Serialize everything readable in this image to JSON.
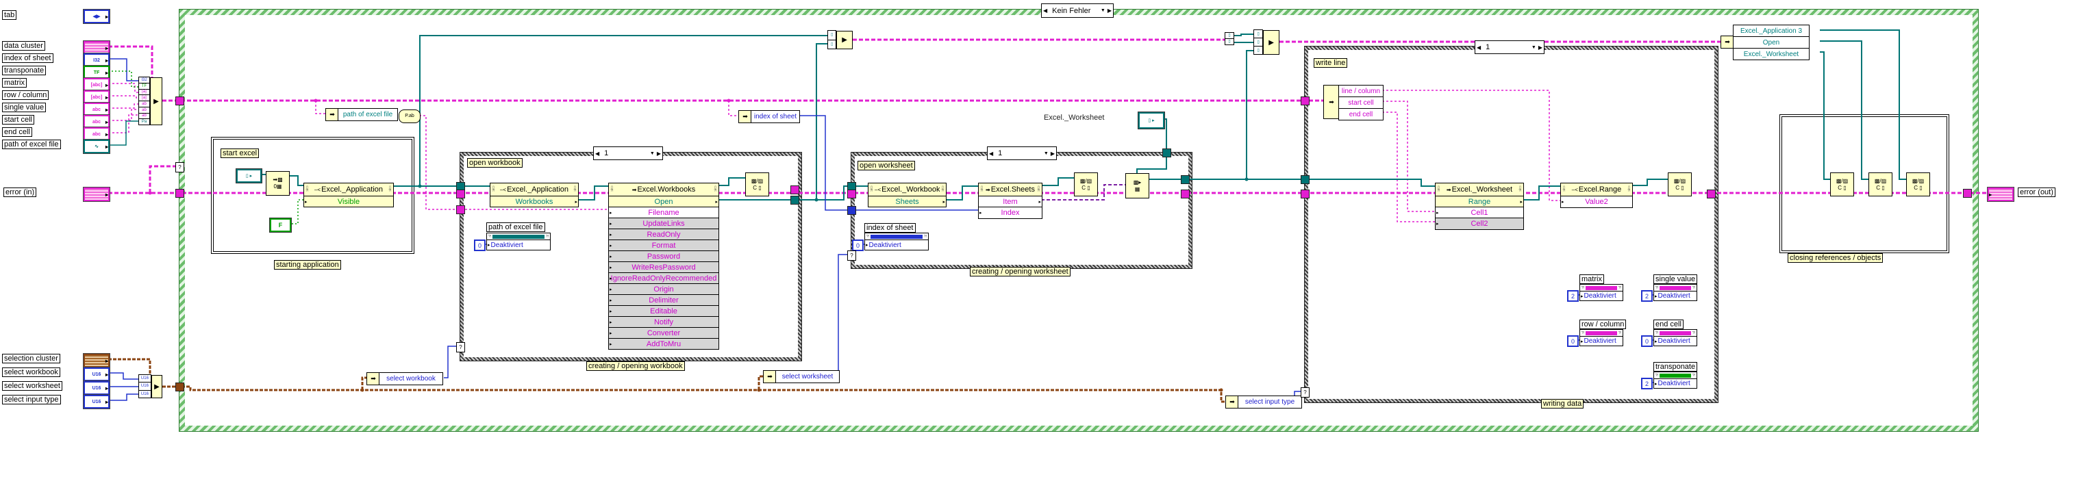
{
  "window": {
    "case_label": "Kein Fehler"
  },
  "selectors": {
    "workbook": "1",
    "worksheet": "1",
    "writing": "1"
  },
  "icons": {
    "arrow_left": "◀",
    "arrow_right": "▶",
    "arrow_down": "▼",
    "in_arrow": "➡",
    "bundle_arrow": "▶",
    "corner": "▯\n?!",
    "bar_corner": "?!",
    "property_glyph": "–<",
    "invoke_glyph": "➡",
    "ref_const": "▯ ▸",
    "ref_cell": "▯",
    "question": "?",
    "automation_open": "➡▩\n0▦",
    "close_reference": "▩/▨\nC ▯",
    "to_specific": "▩▸\n▦",
    "path_to_string": "P.ab"
  },
  "terminals": {
    "tab": {
      "label": "tab",
      "glyph": "◀▶"
    },
    "inputs": [
      {
        "label": "data cluster",
        "glyph": ""
      },
      {
        "label": "index of sheet",
        "glyph": "I32"
      },
      {
        "label": "transponate",
        "glyph": "TF"
      },
      {
        "label": "matrix",
        "glyph": "[abc]"
      },
      {
        "label": "row / column",
        "glyph": "[abc]"
      },
      {
        "label": "single value",
        "glyph": "abc"
      },
      {
        "label": "start cell",
        "glyph": "abc"
      },
      {
        "label": "end cell",
        "glyph": "abc"
      },
      {
        "label": "path of excel file",
        "glyph": "∿"
      }
    ],
    "error_in": {
      "label": "error (in)"
    },
    "error_out": {
      "label": "error (out)"
    },
    "selection": [
      {
        "label": "selection cluster",
        "glyph": ""
      },
      {
        "label": "select workbook",
        "glyph": "U16"
      },
      {
        "label": "select worksheet",
        "glyph": "U16"
      },
      {
        "label": "select input type",
        "glyph": "U16"
      }
    ],
    "bundle_rows": [
      "I32",
      "TF",
      "[a]",
      "[a]",
      "ab",
      "ab",
      "ab",
      "Pa"
    ],
    "selection_bundle_rows": [
      "U16",
      "U16",
      "U16"
    ]
  },
  "sections": {
    "starting": {
      "note": "start excel",
      "caption": "starting application",
      "property": {
        "title": "Excel._Application",
        "row": "Visible"
      },
      "bool_const": "F"
    },
    "workbook": {
      "note": "open workbook",
      "caption": "creating / opening workbook",
      "property": {
        "title": "Excel._Application",
        "row": "Workbooks"
      },
      "invoke": {
        "title": "Excel.Workbooks",
        "method": "Open",
        "params": [
          "Filename",
          "UpdateLinks",
          "ReadOnly",
          "Format",
          "Password",
          "WriteResPassword",
          "IgnoreReadOnlyRecommended",
          "Origin",
          "Delimiter",
          "Editable",
          "Notify",
          "Converter",
          "AddToMru"
        ]
      },
      "disable": {
        "label": "path of excel file",
        "prop": "Deaktiviert",
        "value": "0"
      }
    },
    "worksheet": {
      "note": "open worksheet",
      "caption": "creating / opening worksheet",
      "property": {
        "title": "Excel._Workbook",
        "row": "Sheets"
      },
      "invoke": {
        "title": "Excel.Sheets",
        "rows": [
          "Item",
          "Index"
        ]
      },
      "type_label": "Excel._Worksheet",
      "disable": {
        "label": "index of sheet",
        "prop": "Deaktiviert",
        "value": "0"
      }
    },
    "writing": {
      "note": "write line",
      "caption": "writing data",
      "unbundle": [
        "line / column",
        "start cell",
        "end cell"
      ],
      "invoke": {
        "title": "Excel._Worksheet",
        "rows": [
          "Range",
          "Cell1",
          "Cell2"
        ]
      },
      "property": {
        "title": "Excel.Range",
        "row": "Value2"
      },
      "disable_prop": "Deaktiviert",
      "disables": [
        {
          "label": "matrix",
          "value": "2"
        },
        {
          "label": "single value",
          "value": "2"
        },
        {
          "label": "row / column",
          "value": "0"
        },
        {
          "label": "end cell",
          "value": "0"
        },
        {
          "label": "transponate",
          "value": "2"
        }
      ]
    },
    "closing": {
      "caption": "closing references / objects",
      "refs": [
        "Excel._Application 3",
        "Open",
        "Excel._Worksheet"
      ]
    }
  }
}
